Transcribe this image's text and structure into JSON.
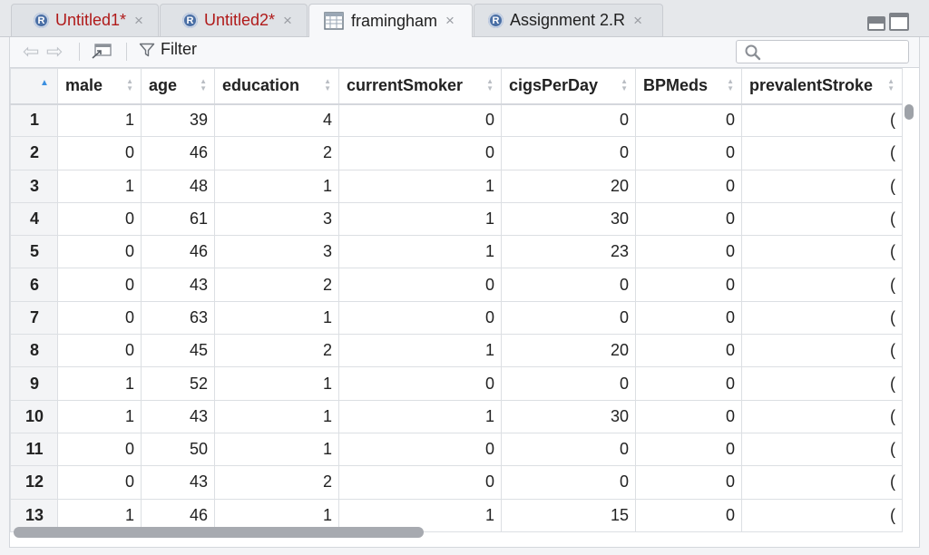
{
  "tabs": [
    {
      "label": "Untitled1*",
      "icon": "r-file-icon",
      "modified": true
    },
    {
      "label": "Untitled2*",
      "icon": "r-file-icon",
      "modified": true
    },
    {
      "label": "framingham",
      "icon": "data-grid-icon",
      "active": true
    },
    {
      "label": "Assignment 2.R",
      "icon": "r-file-icon"
    }
  ],
  "tab_close_glyph": "×",
  "r_icon_letter": "R",
  "toolbar": {
    "filter_label": "Filter",
    "search_placeholder": "",
    "search_value": ""
  },
  "table": {
    "columns": [
      "male",
      "age",
      "education",
      "currentSmoker",
      "cigsPerDay",
      "BPMeds",
      "prevalentStroke"
    ],
    "rows": [
      {
        "index": "1",
        "cells": [
          "1",
          "39",
          "4",
          "0",
          "0",
          "0"
        ]
      },
      {
        "index": "2",
        "cells": [
          "0",
          "46",
          "2",
          "0",
          "0",
          "0"
        ]
      },
      {
        "index": "3",
        "cells": [
          "1",
          "48",
          "1",
          "1",
          "20",
          "0"
        ]
      },
      {
        "index": "4",
        "cells": [
          "0",
          "61",
          "3",
          "1",
          "30",
          "0"
        ]
      },
      {
        "index": "5",
        "cells": [
          "0",
          "46",
          "3",
          "1",
          "23",
          "0"
        ]
      },
      {
        "index": "6",
        "cells": [
          "0",
          "43",
          "2",
          "0",
          "0",
          "0"
        ]
      },
      {
        "index": "7",
        "cells": [
          "0",
          "63",
          "1",
          "0",
          "0",
          "0"
        ]
      },
      {
        "index": "8",
        "cells": [
          "0",
          "45",
          "2",
          "1",
          "20",
          "0"
        ]
      },
      {
        "index": "9",
        "cells": [
          "1",
          "52",
          "1",
          "0",
          "0",
          "0"
        ]
      },
      {
        "index": "10",
        "cells": [
          "1",
          "43",
          "1",
          "1",
          "30",
          "0"
        ]
      },
      {
        "index": "11",
        "cells": [
          "0",
          "50",
          "1",
          "0",
          "0",
          "0"
        ]
      },
      {
        "index": "12",
        "cells": [
          "0",
          "43",
          "2",
          "0",
          "0",
          "0"
        ]
      },
      {
        "index": "13",
        "cells": [
          "1",
          "46",
          "1",
          "1",
          "15",
          "0"
        ]
      }
    ],
    "last_column_partial_glyph": "("
  },
  "colors": {
    "modified_tab_text": "#b01a1a",
    "sort_active": "#3b8fe0",
    "r_icon": "#4a6fa5"
  }
}
